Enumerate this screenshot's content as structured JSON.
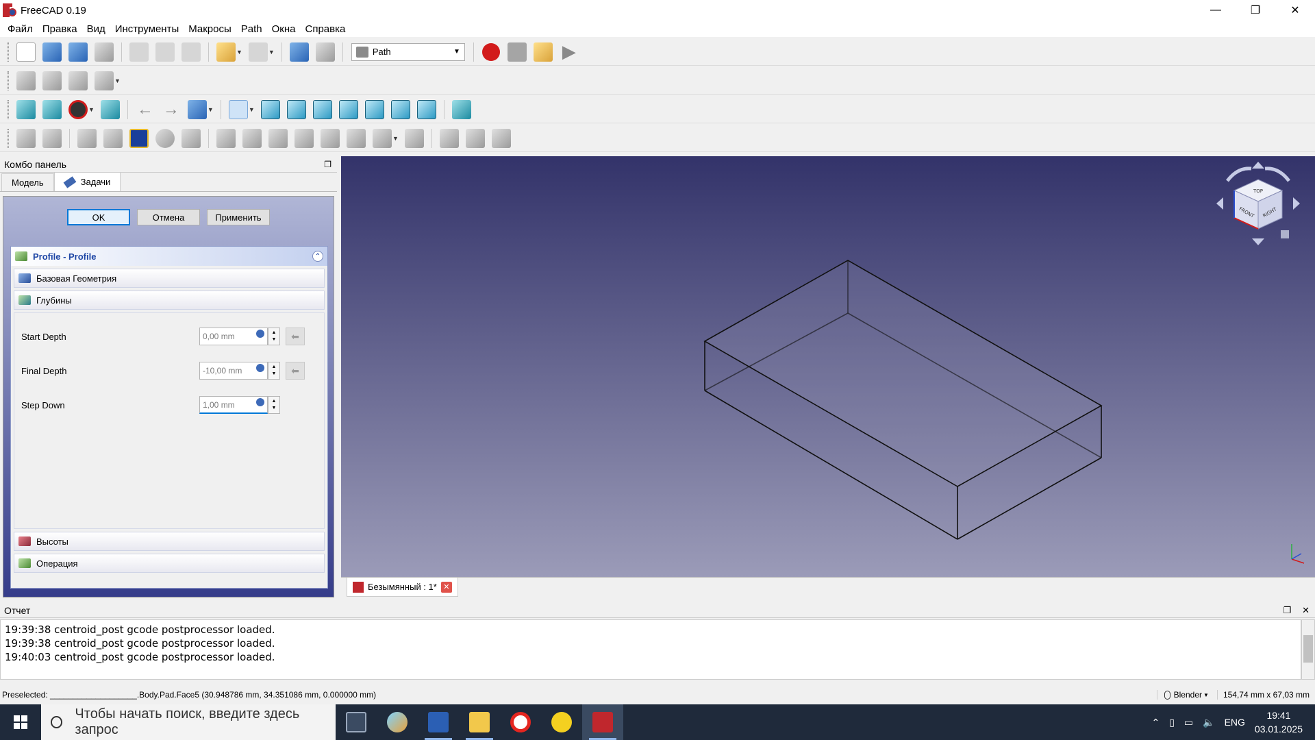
{
  "window": {
    "title": "FreeCAD 0.19",
    "minimize": "—",
    "restore": "❐",
    "close": "✕"
  },
  "menu": [
    "Файл",
    "Правка",
    "Вид",
    "Инструменты",
    "Макросы",
    "Path",
    "Окна",
    "Справка"
  ],
  "toolbar": {
    "workbench": "Path"
  },
  "combo": {
    "title": "Комбо панель",
    "tabs": {
      "model": "Модель",
      "tasks": "Задачи"
    },
    "buttons": {
      "ok": "OK",
      "cancel": "Отмена",
      "apply": "Применить"
    },
    "profile_title": "Profile - Profile",
    "sections": {
      "base_geometry": "Базовая Геометрия",
      "depths": "Глубины",
      "heights": "Высоты",
      "operation": "Операция"
    },
    "fields": {
      "start_depth": {
        "label": "Start Depth",
        "value": "0,00 mm"
      },
      "final_depth": {
        "label": "Final Depth",
        "value": "-10,00 mm"
      },
      "step_down": {
        "label": "Step Down",
        "value": "1,00 mm"
      }
    }
  },
  "document_tab": {
    "label": "Безымянный : 1*"
  },
  "report": {
    "title": "Отчет",
    "lines": [
      "19:39:38  centroid_post gcode postprocessor loaded.",
      "19:39:38  centroid_post gcode postprocessor loaded.",
      "19:40:03  centroid_post gcode postprocessor loaded."
    ]
  },
  "status": {
    "preselected": "Preselected: ___________________.Body.Pad.Face5 (30.948786 mm, 34.351086 mm, 0.000000 mm)",
    "navigation_style": "Blender",
    "dimensions": "154,74 mm x 67,03 mm"
  },
  "taskbar": {
    "search_placeholder": "Чтобы начать поиск, введите здесь запрос",
    "language": "ENG",
    "time": "19:41",
    "date": "03.01.2025"
  },
  "navcube": {
    "faces": [
      "TOP",
      "FRONT",
      "RIGHT"
    ]
  }
}
